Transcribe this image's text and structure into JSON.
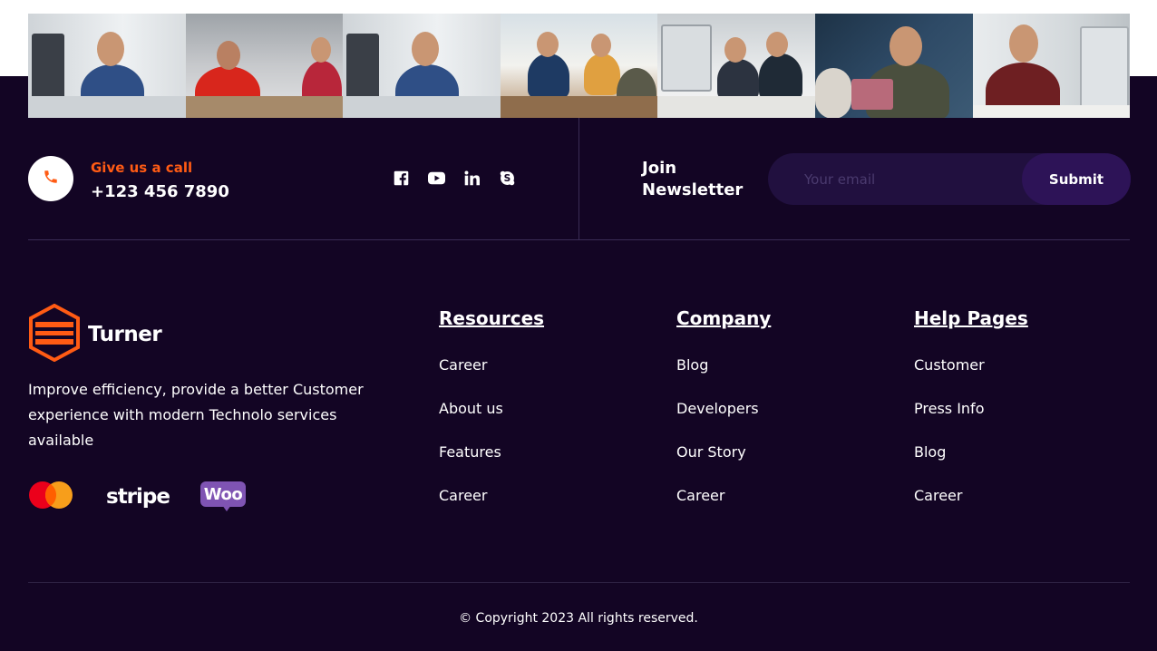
{
  "contact": {
    "call_label": "Give us a call",
    "phone_number": "+123 456 7890",
    "phone_icon": "phone-icon"
  },
  "socials": [
    {
      "name": "facebook",
      "icon": "facebook-icon"
    },
    {
      "name": "youtube",
      "icon": "youtube-icon"
    },
    {
      "name": "linkedin",
      "icon": "linkedin-icon"
    },
    {
      "name": "skype",
      "icon": "skype-icon"
    }
  ],
  "newsletter": {
    "title": "Join Newsletter",
    "placeholder": "Your email",
    "submit_label": "Submit"
  },
  "brand": {
    "name": "Turner",
    "description": "Improve efficiency, provide a better Customer experience with modern Technolo services available"
  },
  "payments": {
    "stripe": "stripe",
    "woo": "Woo"
  },
  "columns": {
    "resources": {
      "title": "Resources",
      "links": [
        "Career",
        "About us",
        "Features",
        "Career"
      ]
    },
    "company": {
      "title": "Company",
      "links": [
        "Blog",
        "Developers",
        "Our Story",
        "Career"
      ]
    },
    "help": {
      "title": "Help Pages",
      "links": [
        "Customer",
        "Press Info",
        "Blog",
        "Career"
      ]
    }
  },
  "copyright": "© Copyright 2023 All rights reserved.",
  "colors": {
    "background": "#130524",
    "accent": "#ff5b14",
    "input_bg": "#21103f",
    "button_bg": "#2d1357"
  }
}
